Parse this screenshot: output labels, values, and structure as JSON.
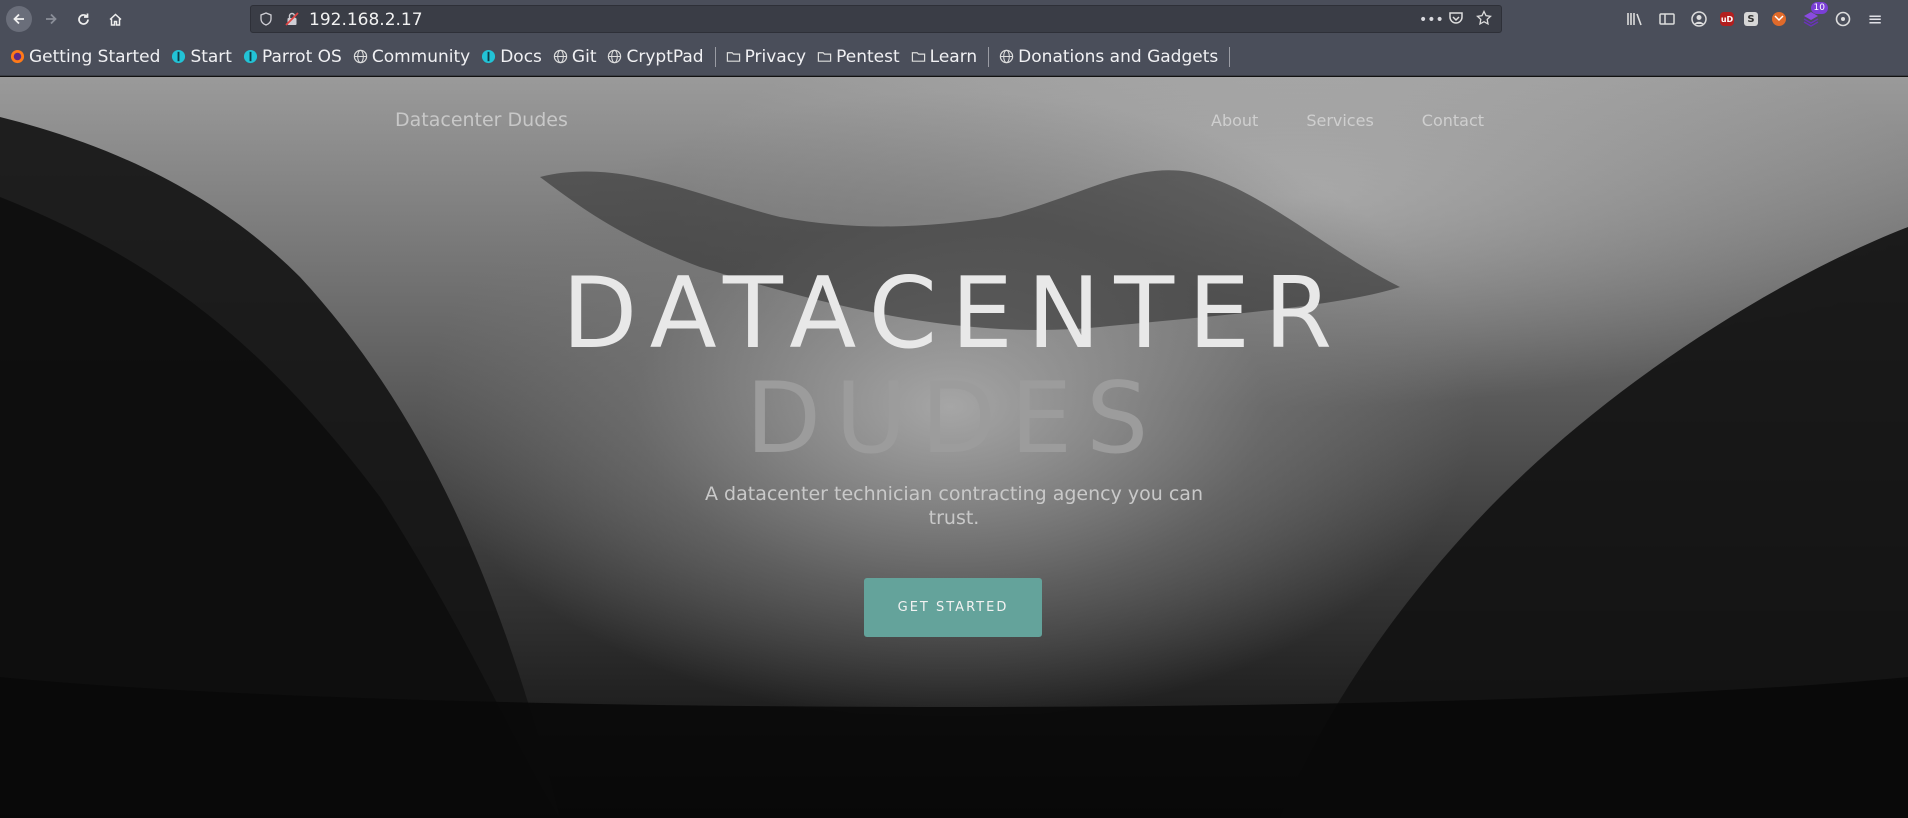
{
  "browser": {
    "url": "192.168.2.17",
    "menu_glyph": "≡",
    "extension_badge_count": "10",
    "ublock_label": "uD",
    "s_label": "S",
    "bookmarks": [
      {
        "label": "Getting Started",
        "icon": "firefox-icon"
      },
      {
        "label": "Start",
        "icon": "parrot-icon"
      },
      {
        "label": "Parrot OS",
        "icon": "parrot-icon"
      },
      {
        "label": "Community",
        "icon": "globe-icon"
      },
      {
        "label": "Docs",
        "icon": "parrot-icon"
      },
      {
        "label": "Git",
        "icon": "globe-icon"
      },
      {
        "label": "CryptPad",
        "icon": "globe-icon"
      },
      {
        "label": "Privacy",
        "icon": "folder-icon"
      },
      {
        "label": "Pentest",
        "icon": "folder-icon"
      },
      {
        "label": "Learn",
        "icon": "folder-icon"
      },
      {
        "label": "Donations and Gadgets",
        "icon": "globe-icon"
      }
    ]
  },
  "site": {
    "brand": "Datacenter Dudes",
    "nav": [
      "About",
      "Services",
      "Contact"
    ],
    "hero_line1": "DATACENTER",
    "hero_line2": "DUDES",
    "tagline": "A datacenter technician contracting agency you can trust.",
    "cta_label": "GET STARTED"
  },
  "colors": {
    "browser_chrome": "#4a4e5a",
    "url_bar": "#3a3d46",
    "cta_background": "#64a39b"
  }
}
